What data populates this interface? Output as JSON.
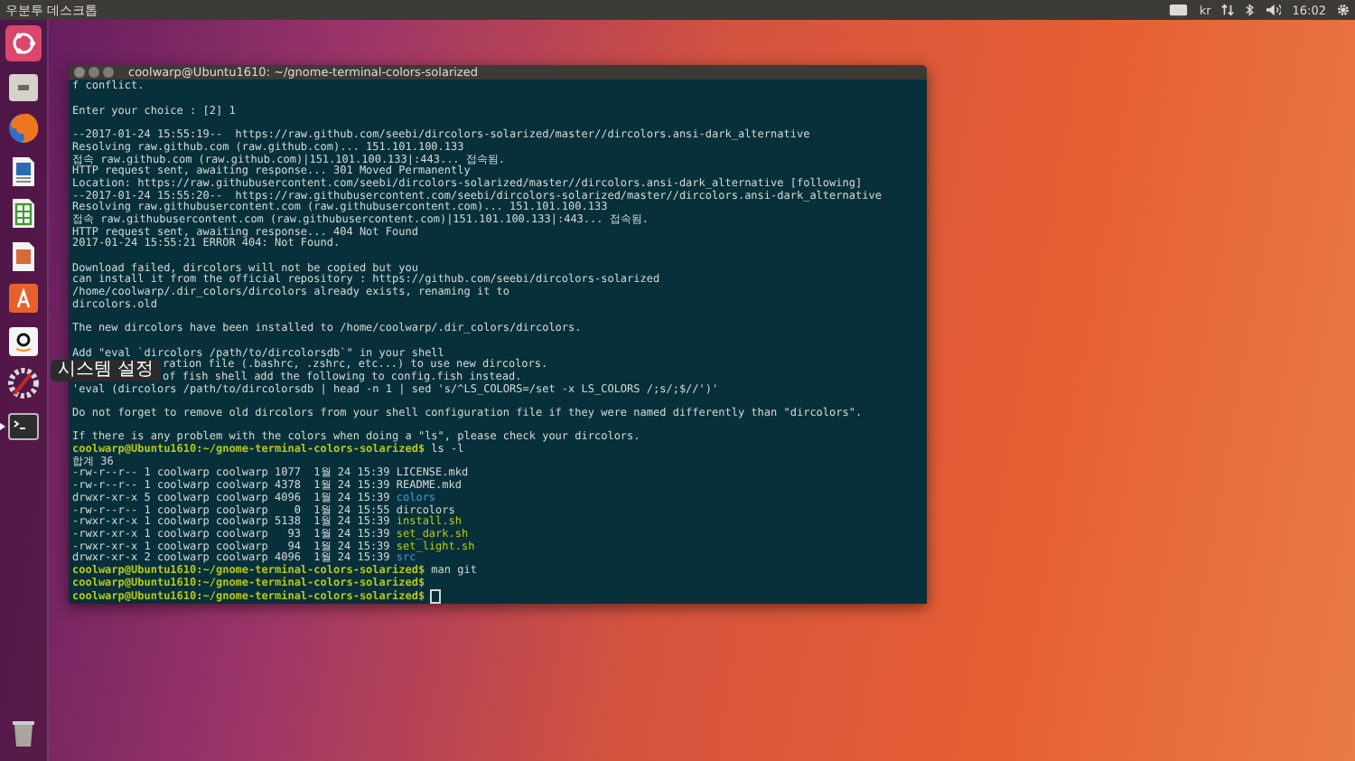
{
  "top_bar": {
    "title": "우분투 데스크톱",
    "keyboard_layout": "kr",
    "clock": "16:02"
  },
  "launcher": {
    "tooltip": "시스템 설정"
  },
  "terminal": {
    "title": "coolwarp@Ubuntu1610: ~/gnome-terminal-colors-solarized",
    "lines": [
      {
        "kind": "text",
        "text": "f conflict."
      },
      {
        "kind": "blank"
      },
      {
        "kind": "text",
        "text": "Enter your choice : [2] 1"
      },
      {
        "kind": "blank"
      },
      {
        "kind": "text",
        "text": "--2017-01-24 15:55:19--  https://raw.github.com/seebi/dircolors-solarized/master//dircolors.ansi-dark_alternative"
      },
      {
        "kind": "text",
        "text": "Resolving raw.github.com (raw.github.com)... 151.101.100.133"
      },
      {
        "kind": "text",
        "text": "접속 raw.github.com (raw.github.com)|151.101.100.133|:443... 접속됨."
      },
      {
        "kind": "text",
        "text": "HTTP request sent, awaiting response... 301 Moved Permanently"
      },
      {
        "kind": "text",
        "text": "Location: https://raw.githubusercontent.com/seebi/dircolors-solarized/master//dircolors.ansi-dark_alternative [following]"
      },
      {
        "kind": "text",
        "text": "--2017-01-24 15:55:20--  https://raw.githubusercontent.com/seebi/dircolors-solarized/master//dircolors.ansi-dark_alternative"
      },
      {
        "kind": "text",
        "text": "Resolving raw.githubusercontent.com (raw.githubusercontent.com)... 151.101.100.133"
      },
      {
        "kind": "text",
        "text": "접속 raw.githubusercontent.com (raw.githubusercontent.com)|151.101.100.133|:443... 접속됨."
      },
      {
        "kind": "text",
        "text": "HTTP request sent, awaiting response... 404 Not Found"
      },
      {
        "kind": "text",
        "text": "2017-01-24 15:55:21 ERROR 404: Not Found."
      },
      {
        "kind": "blank"
      },
      {
        "kind": "text",
        "text": "Download failed, dircolors will not be copied but you"
      },
      {
        "kind": "text",
        "text": "can install it from the official repository : https://github.com/seebi/dircolors-solarized"
      },
      {
        "kind": "text",
        "text": "/home/coolwarp/.dir_colors/dircolors already exists, renaming it to"
      },
      {
        "kind": "text",
        "text": "dircolors.old"
      },
      {
        "kind": "blank"
      },
      {
        "kind": "text",
        "text": "The new dircolors have been installed to /home/coolwarp/.dir_colors/dircolors."
      },
      {
        "kind": "blank"
      },
      {
        "kind": "text",
        "text": "Add \"eval `dircolors /path/to/dircolorsdb`\" in your shell"
      },
      {
        "kind": "covered",
        "text": "ration file (.bashrc, .zshrc, etc...) to use new dircolors."
      },
      {
        "kind": "covered",
        "text": "of fish shell add the following to config.fish instead."
      },
      {
        "kind": "text",
        "text": "'eval (dircolors /path/to/dircolorsdb | head -n 1 | sed 's/^LS_COLORS=/set -x LS_COLORS /;s/;$//')'"
      },
      {
        "kind": "blank"
      },
      {
        "kind": "text",
        "text": "Do not forget to remove old dircolors from your shell configuration file if they were named differently than \"dircolors\"."
      },
      {
        "kind": "blank"
      },
      {
        "kind": "text",
        "text": "If there is any problem with the colors when doing a \"ls\", please check your dircolors."
      },
      {
        "kind": "prompt",
        "prompt": "coolwarp@Ubuntu1610:~/gnome-terminal-colors-solarized$",
        "command": "ls -l"
      },
      {
        "kind": "text",
        "text": "합계 36"
      },
      {
        "kind": "file",
        "info": "-rw-r--r-- 1 coolwarp coolwarp 1077  1월 24 15:39",
        "name": "LICENSE.mkd",
        "color": "#d2d8d8"
      },
      {
        "kind": "file",
        "info": "-rw-r--r-- 1 coolwarp coolwarp 4378  1월 24 15:39",
        "name": "README.mkd",
        "color": "#d2d8d8"
      },
      {
        "kind": "file",
        "info": "drwxr-xr-x 5 coolwarp coolwarp 4096  1월 24 15:39",
        "name": "colors",
        "color": "#3a9be0"
      },
      {
        "kind": "file",
        "info": "-rw-r--r-- 1 coolwarp coolwarp    0  1월 24 15:55",
        "name": "dircolors",
        "color": "#d2d8d8"
      },
      {
        "kind": "file",
        "info": "-rwxr-xr-x 1 coolwarp coolwarp 5138  1월 24 15:39",
        "name": "install.sh",
        "color": "#b6c81a"
      },
      {
        "kind": "file",
        "info": "-rwxr-xr-x 1 coolwarp coolwarp   93  1월 24 15:39",
        "name": "set_dark.sh",
        "color": "#b6c81a"
      },
      {
        "kind": "file",
        "info": "-rwxr-xr-x 1 coolwarp coolwarp   94  1월 24 15:39",
        "name": "set_light.sh",
        "color": "#b6c81a"
      },
      {
        "kind": "file",
        "info": "drwxr-xr-x 2 coolwarp coolwarp 4096  1월 24 15:39",
        "name": "src",
        "color": "#3a9be0"
      },
      {
        "kind": "prompt",
        "prompt": "coolwarp@Ubuntu1610:~/gnome-terminal-colors-solarized$",
        "command": "man git"
      },
      {
        "kind": "prompt",
        "prompt": "coolwarp@Ubuntu1610:~/gnome-terminal-colors-solarized$"
      },
      {
        "kind": "prompt",
        "prompt": "coolwarp@Ubuntu1610:~/gnome-terminal-colors-solarized$",
        "cursor": true
      }
    ]
  }
}
